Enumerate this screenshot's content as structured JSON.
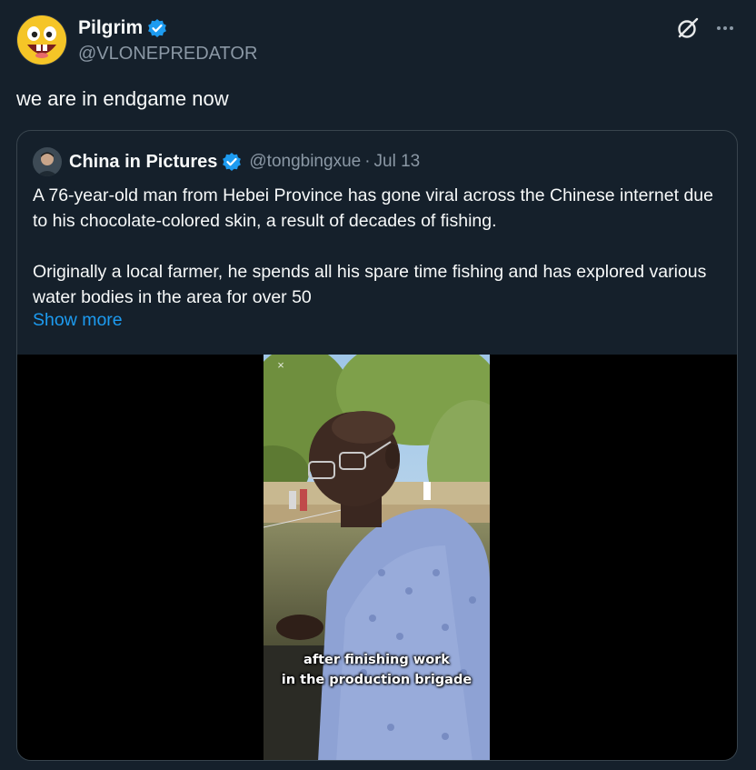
{
  "tweet": {
    "author": {
      "name": "Pilgrim",
      "handle": "@VLONEPREDATOR",
      "avatar_icon": "laughing-emoji-avatar",
      "verified": true
    },
    "text": "we are in endgame now",
    "actions": {
      "grok_icon": "grok-icon",
      "more_icon": "more-icon"
    }
  },
  "quoted": {
    "author": {
      "name": "China in Pictures",
      "handle": "@tongbingxue",
      "separator": "·",
      "date": "Jul 13",
      "verified": true
    },
    "paragraph1": "A 76-year-old man from Hebei Province has gone viral across the Chinese internet due to his chocolate-colored skin, a result of decades of fishing.",
    "paragraph2": "Originally a local farmer, he spends all his spare time fishing and has explored various water bodies in the area for over 50",
    "show_more": "Show more",
    "media": {
      "close_label": "×",
      "caption_line1": "after finishing work",
      "caption_line2": "in the production brigade"
    }
  },
  "colors": {
    "background": "#15202b",
    "text": "#f7f9f9",
    "muted": "#8b98a5",
    "accent": "#1d9bf0",
    "border": "#38444d"
  }
}
